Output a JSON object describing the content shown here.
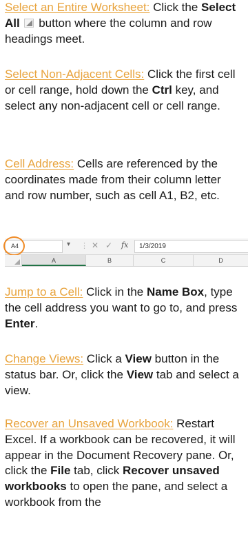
{
  "tips": {
    "select_all": {
      "heading": "Select an Entire Worksheet:",
      "pre": " Click the ",
      "bold": "Select All",
      "post": " button where the column and row headings meet."
    },
    "non_adjacent": {
      "heading": "Select Non-Adjacent Cells:",
      "pre": " Click the first cell or cell range, hold down the ",
      "bold": "Ctrl",
      "post": " key, and select any non-adjacent cell or cell range."
    },
    "cell_address": {
      "heading": "Cell Address:",
      "text": " Cells are referenced by the coordinates made from their column letter and row number, such as cell A1, B2, etc."
    },
    "jump": {
      "heading": "Jump to a Cell:",
      "t1": " Click in the ",
      "b1": "Name Box",
      "t2": ", type the cell address you want to go to, and press ",
      "b2": "Enter",
      "t3": "."
    },
    "views": {
      "heading": "Change Views:",
      "t1": " Click a ",
      "b1": "View",
      "t2": " button in the status bar. Or, click the ",
      "b2": "View",
      "t3": " tab and select a view."
    },
    "recover": {
      "heading": "Recover an Unsaved Workbook:",
      "t1": " Restart Excel. If a workbook can be recovered, it will appear in the Document Recovery pane. Or, click the ",
      "b1": "File",
      "t2": " tab, click ",
      "b2": "Recover unsaved workbooks",
      "t3": " to open the pane, and select a workbook from the"
    }
  },
  "excel": {
    "name_box": "A4",
    "cancel_glyph": "✕",
    "enter_glyph": "✓",
    "fx_label": "fx",
    "formula_value": "1/3/2019",
    "columns": [
      "A",
      "B",
      "C",
      "D"
    ],
    "accent": "#f08a24",
    "link_color": "#e8a33c"
  }
}
